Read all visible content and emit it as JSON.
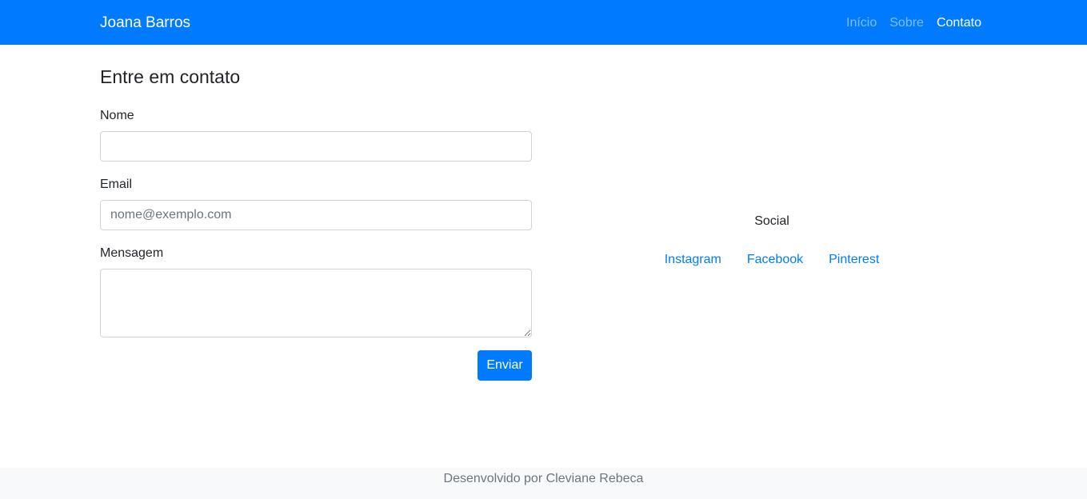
{
  "navbar": {
    "brand": "Joana Barros",
    "links": [
      {
        "label": "Início",
        "active": false
      },
      {
        "label": "Sobre",
        "active": false
      },
      {
        "label": "Contato",
        "active": true
      }
    ]
  },
  "form": {
    "title": "Entre em contato",
    "name_label": "Nome",
    "name_value": "",
    "email_label": "Email",
    "email_placeholder": "nome@exemplo.com",
    "message_label": "Mensagem",
    "message_value": "",
    "submit_label": "Enviar"
  },
  "social": {
    "title": "Social",
    "links": [
      "Instagram",
      "Facebook",
      "Pinterest"
    ]
  },
  "footer": {
    "text": "Desenvolvido por Cleviane Rebeca"
  },
  "colors": {
    "primary": "#007bff",
    "footer_bg": "#f8f9fa",
    "muted_text": "#6c757d"
  }
}
